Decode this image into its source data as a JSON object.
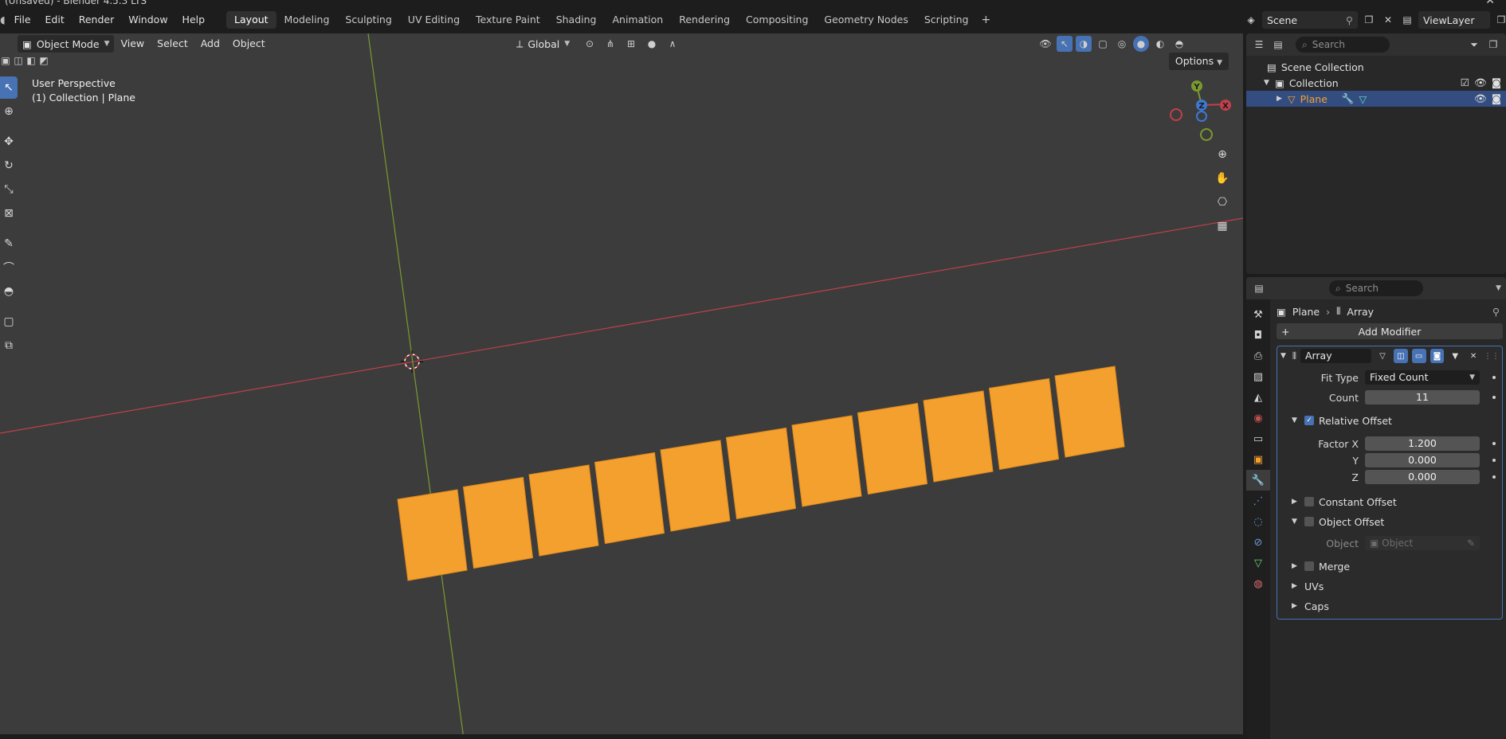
{
  "window": {
    "title": "(Unsaved) - Blender 4.5.3 LTS"
  },
  "menu": {
    "items": [
      "File",
      "Edit",
      "Render",
      "Window",
      "Help"
    ]
  },
  "workspaces": {
    "tabs": [
      "Layout",
      "Modeling",
      "Sculpting",
      "UV Editing",
      "Texture Paint",
      "Shading",
      "Animation",
      "Rendering",
      "Compositing",
      "Geometry Nodes",
      "Scripting"
    ],
    "active": "Layout",
    "add_label": "+"
  },
  "scene": {
    "name": "Scene",
    "view_layer": "ViewLayer"
  },
  "viewport": {
    "mode": "Object Mode",
    "menus": [
      "View",
      "Select",
      "Add",
      "Object"
    ],
    "orientation": "Global",
    "perspective_label": "User Perspective",
    "context_label": "(1) Collection | Plane",
    "options_label": "Options",
    "array_count": 11,
    "object_color": "#f4a02e",
    "background_color": "#3c3c3c",
    "axis_x_color": "#c0404a",
    "axis_y_color": "#7a9a2e",
    "gizmo": {
      "x": "X",
      "y": "Y",
      "z": "Z"
    }
  },
  "outliner": {
    "search_placeholder": "Search",
    "scene_collection": "Scene Collection",
    "collection": "Collection",
    "object": "Plane"
  },
  "properties": {
    "search_placeholder": "Search",
    "breadcrumb": {
      "object": "Plane",
      "modifier": "Array"
    },
    "add_modifier": "Add Modifier",
    "modifier": {
      "name": "Array",
      "fit_type_label": "Fit Type",
      "fit_type_value": "Fixed Count",
      "count_label": "Count",
      "count_value": "11",
      "relative_offset_label": "Relative Offset",
      "relative_offset_enabled": true,
      "factor_x_label": "Factor X",
      "factor_x_value": "1.200",
      "y_label": "Y",
      "y_value": "0.000",
      "z_label": "Z",
      "z_value": "0.000",
      "constant_offset_label": "Constant Offset",
      "object_offset_label": "Object Offset",
      "object_label": "Object",
      "object_placeholder": "Object",
      "merge_label": "Merge",
      "uvs_label": "UVs",
      "caps_label": "Caps"
    }
  }
}
